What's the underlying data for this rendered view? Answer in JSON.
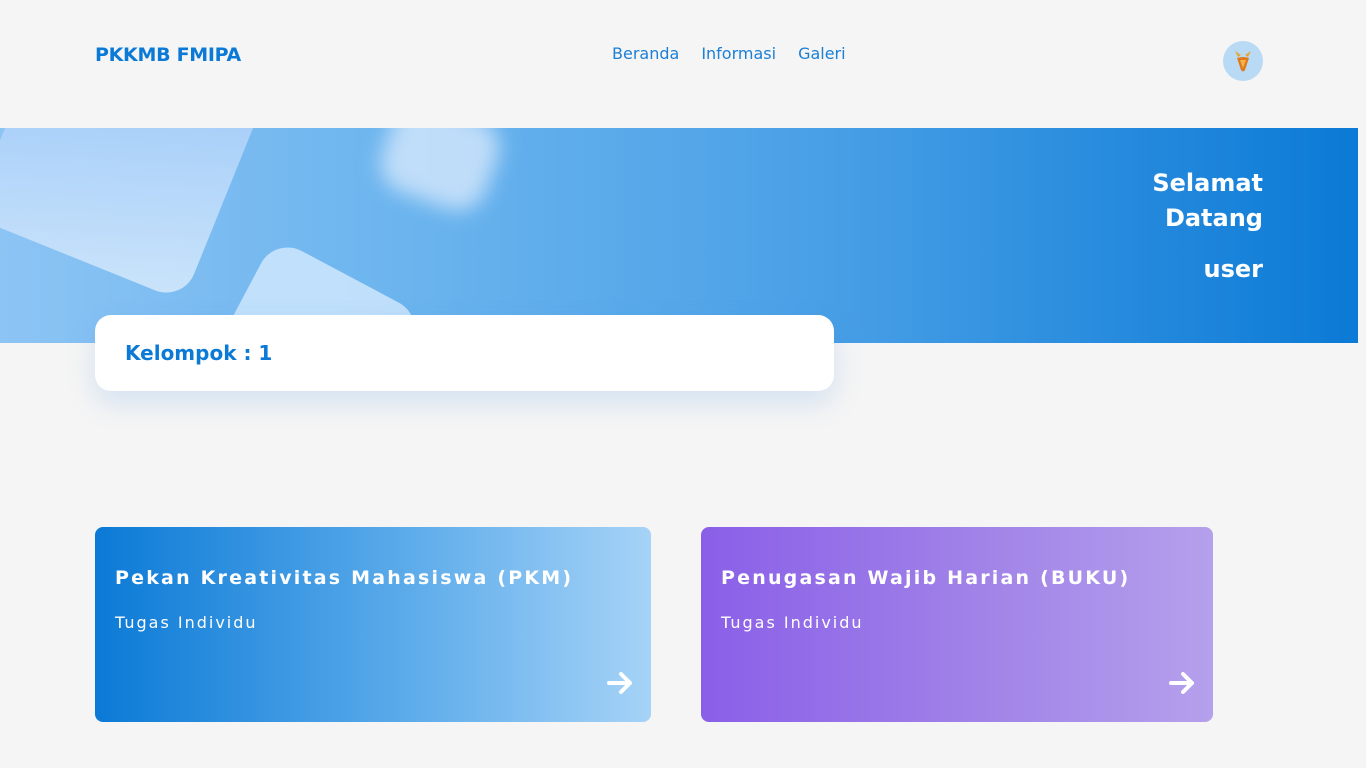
{
  "header": {
    "brand": "PKKMB FMIPA",
    "nav": [
      "Beranda",
      "Informasi",
      "Galeri"
    ],
    "avatar_icon": "deer-logo-icon"
  },
  "hero": {
    "greeting_line1": "Selamat",
    "greeting_line2": "Datang",
    "username": "user"
  },
  "group": {
    "label": "Kelompok : 1"
  },
  "cards": [
    {
      "title": "Pekan Kreativitas Mahasiswa (PKM)",
      "subtitle": "Tugas Individu",
      "icon": "arrow-right-icon",
      "color": "#0b7ad6"
    },
    {
      "title": "Penugasan Wajib Harian (BUKU)",
      "subtitle": "Tugas Individu",
      "icon": "arrow-right-icon",
      "color": "#8a5fe8"
    }
  ],
  "colors": {
    "brand": "#0b7ad6",
    "background": "#f5f5f5"
  }
}
